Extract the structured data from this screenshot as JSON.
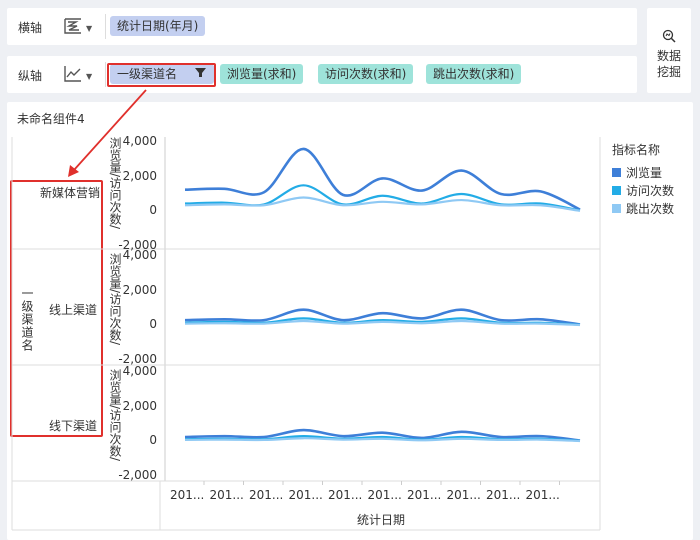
{
  "toolbar": {
    "x_axis_label": "横轴",
    "y_axis_label": "纵轴",
    "x_field": "统计日期(年月)",
    "y_dimension": "一级渠道名",
    "y_metrics": [
      "浏览量(求和)",
      "访问次数(求和)",
      "跳出次数(求和)"
    ],
    "data_mining_label": "数据\n挖掘"
  },
  "widget": {
    "title": "未命名组件4",
    "row_dimension_title": "一级渠道名",
    "y_axis_title": "浏览量/访问次数/",
    "x_axis_title": "统计日期",
    "legend_title": "指标名称"
  },
  "colors": {
    "series_1": "#3e7fd8",
    "series_2": "#23ace6",
    "series_3": "#8fc9f4",
    "highlight": "#e0302c"
  },
  "chart_data": {
    "type": "line",
    "xlabel": "统计日期",
    "ylabel": "浏览量/访问次数/",
    "ylim": [
      -2000,
      4000
    ],
    "yticks": [
      "4,000",
      "2,000",
      "0",
      "-2,000"
    ],
    "x": [
      "201...",
      "201...",
      "201...",
      "201...",
      "201...",
      "201...",
      "201...",
      "201...",
      "201...",
      "201..."
    ],
    "legend": [
      "浏览量",
      "访问次数",
      "跳出次数"
    ],
    "panels": [
      {
        "name": "新媒体营销",
        "series": [
          {
            "name": "浏览量",
            "values": [
              1250,
              1300,
              1100,
              3600,
              950,
              1900,
              1200,
              2350,
              1000,
              1150,
              100
            ]
          },
          {
            "name": "访问次数",
            "values": [
              450,
              500,
              400,
              1500,
              400,
              900,
              450,
              1000,
              400,
              450,
              50
            ]
          },
          {
            "name": "跳出次数",
            "values": [
              350,
              400,
              350,
              800,
              350,
              550,
              400,
              650,
              350,
              350,
              30
            ]
          }
        ]
      },
      {
        "name": "线上渠道",
        "series": [
          {
            "name": "浏览量",
            "values": [
              300,
              350,
              300,
              900,
              300,
              700,
              400,
              900,
              300,
              350,
              50
            ]
          },
          {
            "name": "访问次数",
            "values": [
              150,
              200,
              150,
              400,
              150,
              300,
              200,
              400,
              150,
              150,
              30
            ]
          },
          {
            "name": "跳出次数",
            "values": [
              100,
              120,
              100,
              250,
              100,
              200,
              120,
              250,
              100,
              100,
              20
            ]
          }
        ]
      },
      {
        "name": "线下渠道",
        "series": [
          {
            "name": "浏览量",
            "values": [
              250,
              300,
              250,
              650,
              300,
              500,
              200,
              550,
              250,
              300,
              50
            ]
          },
          {
            "name": "访问次数",
            "values": [
              120,
              150,
              120,
              300,
              150,
              250,
              100,
              250,
              120,
              150,
              30
            ]
          },
          {
            "name": "跳出次数",
            "values": [
              80,
              100,
              80,
              180,
              100,
              150,
              60,
              150,
              80,
              100,
              20
            ]
          }
        ]
      }
    ]
  }
}
